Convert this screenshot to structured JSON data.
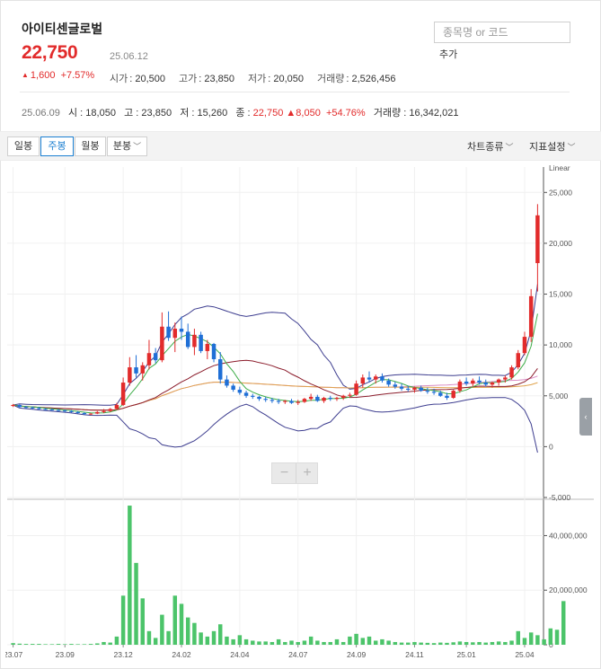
{
  "stock": {
    "name": "아이티센글로벌",
    "price": "22,750",
    "date": "25.06.12",
    "change_abs": "1,600",
    "change_pct": "+7.57%",
    "open_label": "시가",
    "open": "20,500",
    "high_label": "고가",
    "high": "23,850",
    "low_label": "저가",
    "low": "20,050",
    "volume_label": "거래량",
    "volume": "2,526,456"
  },
  "search": {
    "placeholder": "종목명 or 코드",
    "add_label": "추가"
  },
  "weekly": {
    "date": "25.06.09",
    "open_label": "시",
    "open": "18,050",
    "high_label": "고",
    "high": "23,850",
    "low_label": "저",
    "low": "15,260",
    "close_label": "종",
    "close": "22,750",
    "change_abs": "8,050",
    "change_pct": "+54.76%",
    "volume_label": "거래량",
    "volume": "16,342,021"
  },
  "toolbar": {
    "daily": "일봉",
    "weekly": "주봉",
    "monthly": "월봉",
    "minute": "분봉",
    "active": "weekly",
    "chart_type": "차트종류",
    "indicator_settings": "지표설정"
  },
  "zoom": {
    "minus": "−",
    "plus": "+"
  },
  "colors": {
    "up": "#e22b2b",
    "down": "#1f6fd6",
    "volume": "#4cc46a",
    "bollinger": "#3d3d8f",
    "ma_short": "#3fae4a",
    "ma_mid": "#8b1c2b",
    "ma_long1": "#d98cc4",
    "ma_long2": "#e0a24a"
  },
  "chart_data": {
    "type": "candlestick",
    "scale_label": "Linear",
    "price_ylim": [
      -5000,
      27500
    ],
    "price_ticks": [
      {
        "value": 25000,
        "label": "25,000"
      },
      {
        "value": 20000,
        "label": "20,000"
      },
      {
        "value": 15000,
        "label": "15,000"
      },
      {
        "value": 10000,
        "label": "10,000"
      },
      {
        "value": 5000,
        "label": "5,000"
      },
      {
        "value": 0,
        "label": "0"
      },
      {
        "value": -5000,
        "label": "-5,000"
      }
    ],
    "volume_ylim": [
      0,
      52000000
    ],
    "volume_ticks": [
      {
        "value": 40000000,
        "label": "40,000,000"
      },
      {
        "value": 20000000,
        "label": "20,000,000"
      },
      {
        "value": 0,
        "label": "0"
      }
    ],
    "x_labels": [
      {
        "index": 0,
        "label": "23.07"
      },
      {
        "index": 8,
        "label": "23.09"
      },
      {
        "index": 17,
        "label": "23.12"
      },
      {
        "index": 26,
        "label": "24.02"
      },
      {
        "index": 35,
        "label": "24.04"
      },
      {
        "index": 44,
        "label": "24.07"
      },
      {
        "index": 53,
        "label": "24.09"
      },
      {
        "index": 62,
        "label": "24.11"
      },
      {
        "index": 70,
        "label": "25.01"
      },
      {
        "index": 79,
        "label": "25.04"
      }
    ],
    "candles": [
      [
        4000,
        4200,
        3900,
        4100
      ],
      [
        4100,
        4150,
        3800,
        3900
      ],
      [
        3900,
        4000,
        3750,
        3850
      ],
      [
        3850,
        3950,
        3700,
        3800
      ],
      [
        3800,
        3900,
        3650,
        3700
      ],
      [
        3700,
        3800,
        3600,
        3650
      ],
      [
        3650,
        3750,
        3550,
        3600
      ],
      [
        3600,
        3700,
        3500,
        3550
      ],
      [
        3550,
        3650,
        3400,
        3500
      ],
      [
        3500,
        3600,
        3350,
        3400
      ],
      [
        3400,
        3500,
        3250,
        3300
      ],
      [
        3300,
        3400,
        3150,
        3200
      ],
      [
        3200,
        3300,
        3100,
        3250
      ],
      [
        3250,
        3500,
        3200,
        3400
      ],
      [
        3400,
        3700,
        3300,
        3500
      ],
      [
        3500,
        3800,
        3400,
        3700
      ],
      [
        3700,
        4300,
        3600,
        4100
      ],
      [
        4100,
        6800,
        4000,
        6300
      ],
      [
        6300,
        8800,
        6000,
        7800
      ],
      [
        7800,
        9000,
        6800,
        7200
      ],
      [
        7200,
        8300,
        6500,
        8000
      ],
      [
        8000,
        10500,
        7600,
        9200
      ],
      [
        9200,
        9700,
        8200,
        8500
      ],
      [
        8500,
        13200,
        8300,
        11800
      ],
      [
        11800,
        13300,
        10400,
        10700
      ],
      [
        10700,
        12200,
        9300,
        11600
      ],
      [
        11600,
        12800,
        10500,
        11300
      ],
      [
        11300,
        12100,
        9600,
        9800
      ],
      [
        9800,
        11600,
        9000,
        11000
      ],
      [
        11000,
        11300,
        9200,
        9400
      ],
      [
        9400,
        10500,
        8600,
        10100
      ],
      [
        10100,
        10200,
        8300,
        8600
      ],
      [
        8600,
        9300,
        6200,
        6600
      ],
      [
        6600,
        7000,
        5800,
        6000
      ],
      [
        6000,
        6200,
        5400,
        5600
      ],
      [
        5600,
        5900,
        5100,
        5300
      ],
      [
        5300,
        5500,
        4800,
        5000
      ],
      [
        5000,
        5200,
        4700,
        4900
      ],
      [
        4900,
        5000,
        4500,
        4700
      ],
      [
        4700,
        4900,
        4400,
        4600
      ],
      [
        4600,
        4800,
        4300,
        4500
      ],
      [
        4500,
        4700,
        4200,
        4400
      ],
      [
        4400,
        4600,
        4200,
        4500
      ],
      [
        4500,
        4700,
        4200,
        4300
      ],
      [
        4300,
        4600,
        4100,
        4400
      ],
      [
        4400,
        4800,
        4300,
        4700
      ],
      [
        4700,
        5200,
        4500,
        4900
      ],
      [
        4900,
        5100,
        4400,
        4500
      ],
      [
        4500,
        4900,
        4300,
        4800
      ],
      [
        4800,
        5000,
        4500,
        4700
      ],
      [
        4700,
        4900,
        4500,
        4800
      ],
      [
        4800,
        5100,
        4600,
        5000
      ],
      [
        5000,
        5300,
        4800,
        5100
      ],
      [
        5100,
        6500,
        5000,
        6200
      ],
      [
        6200,
        7100,
        5800,
        6800
      ],
      [
        6800,
        7400,
        6300,
        6600
      ],
      [
        6600,
        7100,
        6200,
        6900
      ],
      [
        6900,
        7200,
        6300,
        6500
      ],
      [
        6500,
        6700,
        5900,
        6100
      ],
      [
        6100,
        6400,
        5700,
        5900
      ],
      [
        5900,
        6200,
        5500,
        5700
      ],
      [
        5700,
        6000,
        5400,
        5600
      ],
      [
        5600,
        5900,
        5300,
        5800
      ],
      [
        5800,
        6000,
        5400,
        5500
      ],
      [
        5500,
        5800,
        5200,
        5400
      ],
      [
        5400,
        5700,
        5100,
        5300
      ],
      [
        5300,
        5500,
        4900,
        5000
      ],
      [
        5000,
        5300,
        4600,
        4800
      ],
      [
        4800,
        5600,
        4700,
        5500
      ],
      [
        5500,
        6600,
        5300,
        6400
      ],
      [
        6400,
        6800,
        6000,
        6200
      ],
      [
        6200,
        6700,
        5900,
        6500
      ],
      [
        6500,
        6900,
        6100,
        6300
      ],
      [
        6300,
        6600,
        5900,
        6100
      ],
      [
        6100,
        6400,
        5800,
        6300
      ],
      [
        6300,
        6700,
        6000,
        6600
      ],
      [
        6600,
        7000,
        6300,
        6800
      ],
      [
        6800,
        8000,
        6600,
        7800
      ],
      [
        7800,
        9500,
        7600,
        9200
      ],
      [
        9200,
        11300,
        9000,
        10800
      ],
      [
        10800,
        15500,
        10300,
        14800
      ],
      [
        18050,
        23850,
        15260,
        22750
      ]
    ],
    "volumes": [
      0.6,
      0.4,
      0.3,
      0.3,
      0.3,
      0.2,
      0.2,
      0.3,
      0.2,
      0.3,
      0.2,
      0.2,
      0.3,
      0.5,
      1.0,
      0.8,
      3.0,
      18,
      51,
      30,
      17,
      5,
      2.5,
      11,
      5,
      18,
      15,
      10,
      8,
      4.5,
      3,
      5,
      7.5,
      3,
      2,
      3.5,
      2,
      1.5,
      1.2,
      1.2,
      1.0,
      2,
      1,
      1.5,
      1,
      1.5,
      3,
      1.5,
      1,
      1,
      2,
      1,
      3,
      4,
      2.5,
      3,
      1.5,
      2,
      1.5,
      1,
      0.8,
      0.8,
      1,
      0.8,
      0.7,
      0.6,
      0.8,
      0.7,
      0.9,
      1.2,
      1,
      0.9,
      1,
      0.8,
      1,
      1.2,
      1,
      1.5,
      5,
      2.5,
      4.5,
      3.5,
      2,
      6,
      5.5,
      16
    ]
  }
}
